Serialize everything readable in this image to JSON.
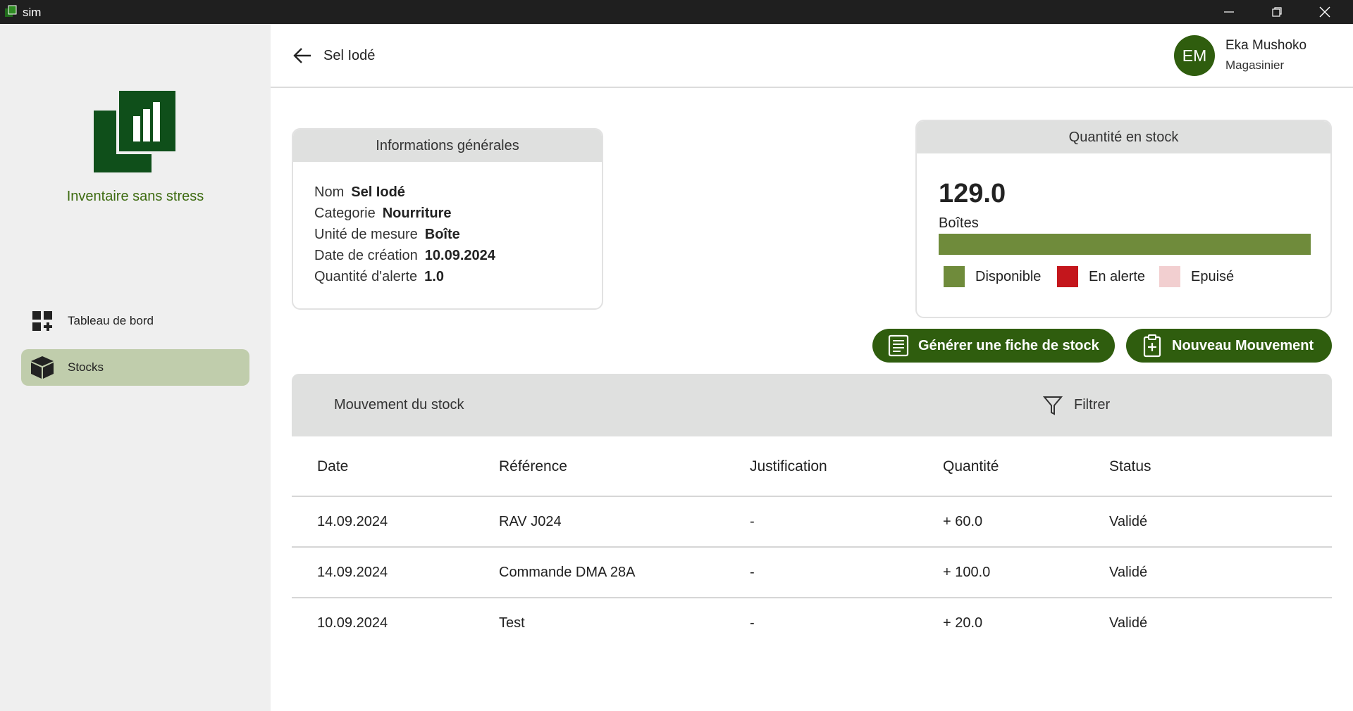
{
  "window": {
    "title": "sim"
  },
  "sidebar": {
    "brand": "Inventaire sans stress",
    "items": [
      {
        "label": "Tableau de bord",
        "icon": "dashboard-add-icon",
        "active": false
      },
      {
        "label": "Stocks",
        "icon": "box-icon",
        "active": true
      }
    ]
  },
  "header": {
    "title": "Sel Iodé",
    "user": {
      "initials": "EM",
      "name": "Eka Mushoko",
      "role": "Magasinier"
    }
  },
  "info": {
    "title": "Informations générales",
    "rows": [
      {
        "label": "Nom",
        "value": "Sel Iodé"
      },
      {
        "label": "Categorie",
        "value": "Nourriture"
      },
      {
        "label": "Unité de mesure",
        "value": "Boîte"
      },
      {
        "label": "Date de création",
        "value": "10.09.2024"
      },
      {
        "label": "Quantité d'alerte",
        "value": "1.0"
      }
    ]
  },
  "stock": {
    "title": "Quantité en stock",
    "quantity": "129.0",
    "unit": "Boîtes",
    "level_fraction": 1.0,
    "legend": [
      {
        "label": "Disponible",
        "color": "#6f8b3b"
      },
      {
        "label": "En alerte",
        "color": "#c4161c"
      },
      {
        "label": "Epuisé",
        "color": "#f2cfd0"
      }
    ]
  },
  "actions": {
    "generate_label": "Générer une fiche de stock",
    "new_movement_label": "Nouveau Mouvement"
  },
  "movements": {
    "title": "Mouvement du stock",
    "filter_label": "Filtrer",
    "columns": [
      "Date",
      "Référence",
      "Justification",
      "Quantité",
      "Status"
    ],
    "rows": [
      [
        "14.09.2024",
        "RAV J024",
        "-",
        "+ 60.0",
        "Validé"
      ],
      [
        "14.09.2024",
        "Commande DMA 28A",
        "-",
        "+ 100.0",
        "Validé"
      ],
      [
        "10.09.2024",
        "Test",
        "-",
        "+ 20.0",
        "Validé"
      ]
    ]
  },
  "colors": {
    "brand_dark": "#2f5d0e",
    "brand_text": "#3d6b10",
    "active_nav": "#c0cdac",
    "panel_gray": "#dfe0df"
  }
}
